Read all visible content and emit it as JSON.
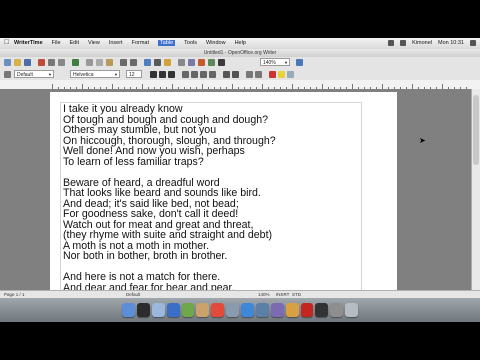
{
  "menubar": {
    "app_name": "WriterTIme",
    "items": [
      "File",
      "Edit",
      "View",
      "Insert",
      "Format",
      "Table",
      "Tools",
      "Window",
      "Help"
    ],
    "active_item": "Table",
    "clock": "Mon 10:31",
    "user": "Kimonel"
  },
  "window": {
    "title": "Untitled1 - OpenOffice.org Writer"
  },
  "format_bar": {
    "style": "Default",
    "font": "Helvetica",
    "size": "12",
    "zoom": "140%"
  },
  "document": {
    "stanzas": [
      {
        "lines": [
          "I take it you already know",
          "Of tough and bough and cough and dough?",
          "Others may stumble, but not you",
          "On hiccough, thorough, slough, and through?",
          "Well done! And now you wish, perhaps",
          "To learn of less familiar traps?"
        ]
      },
      {
        "lines": [
          "Beware of heard, a dreadful word",
          "That looks like beard and sounds like bird.",
          "And dead; it's said like bed, not bead;",
          "For goodness sake, don't call it deed!",
          "Watch out for meat and great and threat,",
          "(they rhyme with suite and straight and debt)",
          "A moth is not a moth in mother.",
          "Nor both in bother, broth in brother."
        ]
      },
      {
        "lines": [
          "And here is not a match for there.",
          "And dear and fear for bear and pear."
        ]
      }
    ]
  },
  "statusbar": {
    "page": "Page 1 / 1",
    "style": "Default",
    "zoom": "140%",
    "mode": "INSRT",
    "std": "STD"
  },
  "dock": {
    "icons": [
      "finder-icon",
      "dashboard-icon",
      "mail-icon",
      "safari-icon",
      "ichat-icon",
      "addressbook-icon",
      "ical-icon",
      "preview-icon",
      "itunes-icon",
      "iphoto-icon",
      "imovie-icon",
      "garageband-icon",
      "filezilla-icon",
      "terminal-icon",
      "preferences-icon",
      "trash-icon"
    ],
    "colors": [
      "#5b8fd6",
      "#2c2c2c",
      "#9ab7dc",
      "#3b6fc7",
      "#6fa84a",
      "#c9a36b",
      "#e24a3a",
      "#8a9bb0",
      "#3f88d8",
      "#5c7fa8",
      "#7c6bb3",
      "#d6a043",
      "#c2261e",
      "#333333",
      "#8e8e8e",
      "#b7bcc2"
    ]
  }
}
